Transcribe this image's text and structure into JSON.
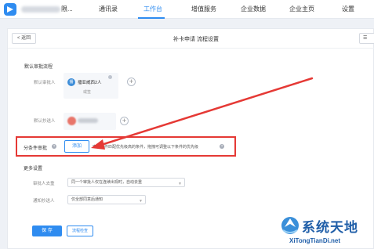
{
  "topnav": {
    "org_suffix": "限...",
    "items": [
      {
        "label": "通讯录",
        "active": false
      },
      {
        "label": "工作台",
        "active": true
      },
      {
        "label": "增值服务",
        "active": false
      },
      {
        "label": "企业数据",
        "active": false
      },
      {
        "label": "企业主页",
        "active": false
      },
      {
        "label": "设置",
        "active": false
      }
    ]
  },
  "header": {
    "back_label": "< 返回",
    "title": "补卡申请 流程设置",
    "right_btn_label": "☰"
  },
  "default_flow": {
    "title": "默认审批流程",
    "approver_label": "默认审批人",
    "approver_name": "播亚威西2人",
    "approver_sub": "或签",
    "avatar_text": "播",
    "cc_label": "默认抄送人"
  },
  "condition": {
    "label": "分条件审批",
    "help": "?",
    "add_label": "添加",
    "desc": "审批条件匹配优先级高的条件，拖拽可调整以下条件的优先级"
  },
  "more_settings": {
    "title": "更多设置",
    "dedupe_label": "审批人去重",
    "dedupe_value": "同一个审批人仅在连续出现时，自动去重",
    "notify_label": "通知抄送人",
    "notify_value": "仅全部同意后通知"
  },
  "footer": {
    "save_label": "保 存",
    "check_label": "流程检查"
  },
  "watermark": {
    "title": "系统天地",
    "domain": "XiTongTianDi.net"
  },
  "colors": {
    "accent": "#2f8cf0",
    "highlight": "#e53935"
  }
}
